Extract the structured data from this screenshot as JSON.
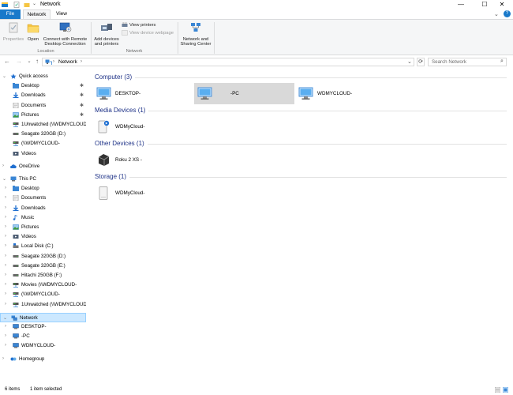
{
  "window": {
    "title": "Network",
    "controls": {
      "minimize": "—",
      "maximize": "☐",
      "close": "✕"
    },
    "expand_ribbon_glyph": "⌄",
    "help_glyph": "?"
  },
  "ribbon_tabs": [
    "File",
    "Network",
    "View"
  ],
  "ribbon": {
    "location_buttons": [
      {
        "label": "Properties",
        "disabled": true
      },
      {
        "label": "Open",
        "disabled": false
      },
      {
        "label": "Connect with Remote Desktop Connection",
        "disabled": false
      }
    ],
    "location_group_label": "Location",
    "network_buttons": [
      {
        "label": "Add devices and printers"
      }
    ],
    "network_small": [
      {
        "label": "View printers",
        "disabled": false
      },
      {
        "label": "View device webpage",
        "disabled": true
      }
    ],
    "network_group_label": "Network",
    "nsc_button": {
      "label": "Network and Sharing Center"
    }
  },
  "address": {
    "back": "←",
    "forward": "→",
    "recent": "⌄",
    "up": "↑",
    "path": "Network",
    "path_chevron": "›",
    "dropdown_glyph": "⌄",
    "refresh_glyph": "⟳",
    "search_placeholder": "Search Network",
    "search_glyph": "⌕"
  },
  "nav": {
    "quick_access": {
      "label": "Quick access",
      "items": [
        {
          "label": "Desktop",
          "icon": "folder-blue-icon",
          "pinned": true
        },
        {
          "label": "Downloads",
          "icon": "download-icon",
          "pinned": true
        },
        {
          "label": "Documents",
          "icon": "documents-icon",
          "pinned": true
        },
        {
          "label": "Pictures",
          "icon": "pictures-icon",
          "pinned": true
        },
        {
          "label": "1Unwatched (\\\\WDMYCLOUD",
          "icon": "network-drive-icon",
          "pinned": false
        },
        {
          "label": "Seagate 320GB (D:)",
          "icon": "drive-icon",
          "pinned": false
        },
        {
          "label": "(\\\\WDMYCLOUD-",
          "icon": "network-drive-icon",
          "pinned": false
        },
        {
          "label": "Videos",
          "icon": "videos-icon",
          "pinned": false
        }
      ]
    },
    "onedrive": {
      "label": "OneDrive"
    },
    "this_pc": {
      "label": "This PC",
      "items": [
        {
          "label": "Desktop",
          "icon": "folder-blue-icon"
        },
        {
          "label": "Documents",
          "icon": "documents-icon"
        },
        {
          "label": "Downloads",
          "icon": "download-icon"
        },
        {
          "label": "Music",
          "icon": "music-icon"
        },
        {
          "label": "Pictures",
          "icon": "pictures-icon"
        },
        {
          "label": "Videos",
          "icon": "videos-icon"
        },
        {
          "label": "Local Disk (C:)",
          "icon": "windows-drive-icon"
        },
        {
          "label": "Seagate 320GB (D:)",
          "icon": "drive-icon"
        },
        {
          "label": "Seagate 320GB (E:)",
          "icon": "drive-icon"
        },
        {
          "label": "Hitachi 250GB (F:)",
          "icon": "drive-icon"
        },
        {
          "label": "Movies (\\\\WDMYCLOUD-",
          "icon": "network-drive-icon"
        },
        {
          "label": "(\\\\WDMYCLOUD-",
          "icon": "network-drive-icon"
        },
        {
          "label": "1Unwatched (\\\\WDMYCLOUD",
          "icon": "network-drive-icon"
        }
      ]
    },
    "network": {
      "label": "Network",
      "items": [
        {
          "label": "DESKTOP-"
        },
        {
          "label": "-PC"
        },
        {
          "label": "WDMYCLOUD-"
        }
      ]
    },
    "homegroup": {
      "label": "Homegroup"
    }
  },
  "content": {
    "groups": [
      {
        "header": "Computer (3)",
        "items": [
          {
            "label": "DESKTOP-",
            "icon": "computer-icon",
            "selected": false
          },
          {
            "label": "-PC",
            "icon": "computer-icon",
            "selected": true
          },
          {
            "label": "WDMYCLOUD-",
            "icon": "computer-icon",
            "selected": false
          }
        ]
      },
      {
        "header": "Media Devices (1)",
        "items": [
          {
            "label": "WDMyCloud-",
            "icon": "media-server-icon"
          }
        ]
      },
      {
        "header": "Other Devices (1)",
        "items": [
          {
            "label": "Roku 2 XS -",
            "icon": "roku-icon"
          }
        ]
      },
      {
        "header": "Storage (1)",
        "items": [
          {
            "label": "WDMyCloud-",
            "icon": "nas-storage-icon"
          }
        ]
      }
    ]
  },
  "status": {
    "items_count": "6 items",
    "selected": "1 item selected"
  },
  "colors": {
    "accent": "#1979ca",
    "selection": "#cce8ff",
    "header_text": "#1e3287"
  }
}
